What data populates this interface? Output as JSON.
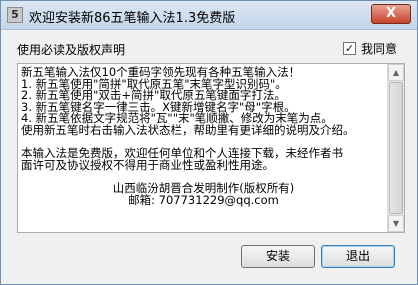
{
  "window": {
    "title": "欢迎安装新86五笔输入法1.3免费版",
    "close_glyph": "X",
    "app_icon_glyph": "5"
  },
  "header": {
    "label": "使用必读及版权声明",
    "agree_label": "我同意",
    "agree_checked_glyph": "✓"
  },
  "text_lines": [
    "新五笔输入法仅10个重码字领先现有各种五笔输入法！",
    "  1. 新五笔使用\"简拼\"取代原五笔\"末笔字型识别码\"。",
    "  2. 新五笔使用\"双击+简拼\"取代原五笔键面字打法。",
    "  3. 新五笔键名字一律三击。X键新增键名字\"母\"字根。",
    "  4. 新五笔依据文字规范将\"瓦\"\"末\"笔顺撇、修改为末笔为点。",
    "   使用新五笔时右击输入法状态栏，帮助里有更详细的说明及介绍。",
    "",
    "   本输入法是免费版，欢迎任何单位和个人连接下载，未经作者书",
    "面许可及协议授权不得用于商业性或盈利性用途。",
    "",
    "山西临汾胡晋合发明制作(版权所有)",
    "邮箱: 707731229@qq.com"
  ],
  "centered_lines": [
    10,
    11
  ],
  "buttons": {
    "install": "安装",
    "exit": "退出"
  },
  "scrollbar": {
    "up_glyph": "▲",
    "down_glyph": "▼"
  }
}
